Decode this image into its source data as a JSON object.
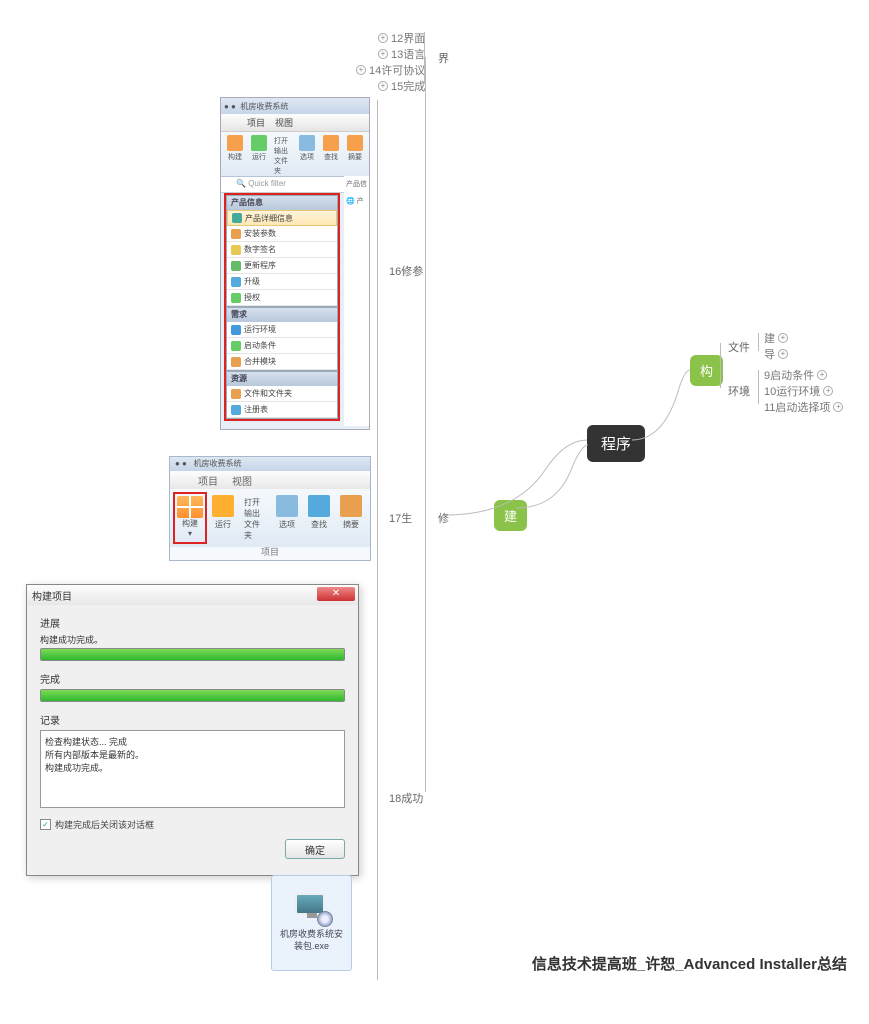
{
  "top_nodes": [
    {
      "label": "12界面"
    },
    {
      "label": "13语言"
    },
    {
      "label": "14许可协议"
    },
    {
      "label": "15完成"
    }
  ],
  "top_group": "界",
  "mid_label": "16修参",
  "panel1": {
    "title": "机房收费系统",
    "tabs": [
      "项目",
      "视图"
    ],
    "ribbon": [
      {
        "t": "构建",
        "c": "#f6a04c"
      },
      {
        "t": "运行",
        "c": "#6c6"
      },
      {
        "t": "打开输出文件夹",
        "c": "#5ad"
      },
      {
        "t": "选项",
        "c": "#8bd"
      },
      {
        "t": "查找",
        "c": "#f6a04c"
      },
      {
        "t": "摘要",
        "c": "#f6a04c"
      }
    ],
    "filter": "Quick filter",
    "right_tab": "产品信",
    "groups": [
      {
        "name": "产品信息",
        "items": [
          {
            "t": "产品详细信息",
            "c": "#4a9",
            "sel": true
          },
          {
            "t": "安装参数",
            "c": "#e8a050"
          },
          {
            "t": "数字签名",
            "c": "#e8c850"
          },
          {
            "t": "更新程序",
            "c": "#6b6"
          },
          {
            "t": "升级",
            "c": "#5ad"
          },
          {
            "t": "授权",
            "c": "#6c6"
          }
        ]
      },
      {
        "name": "需求",
        "items": [
          {
            "t": "运行环境",
            "c": "#4499dd"
          },
          {
            "t": "启动条件",
            "c": "#6c6"
          },
          {
            "t": "合并模块",
            "c": "#e8a050"
          }
        ]
      },
      {
        "name": "资源",
        "items": [
          {
            "t": "文件和文件夹",
            "c": "#e8a050"
          },
          {
            "t": "注册表",
            "c": "#5ad"
          }
        ]
      }
    ]
  },
  "panel2": {
    "title": "机房收费系统",
    "tabs": [
      "项目",
      "视图"
    ],
    "highlight": "构建",
    "btns": [
      {
        "t": "运行",
        "c": "#ffb030"
      },
      {
        "t": "打开输出文件夹",
        "c": "#5ad"
      },
      {
        "t": "选项",
        "c": "#8bd"
      },
      {
        "t": "查找",
        "c": "#5ad"
      },
      {
        "t": "摘要",
        "c": "#e8a050"
      }
    ],
    "section": "项目"
  },
  "side_17": "17生",
  "side_mod": "修",
  "dialog": {
    "title": "构建项目",
    "sec1": "进展",
    "msg1": "构建成功完成。",
    "sec2": "完成",
    "sec3": "记录",
    "log": [
      "检查构建状态... 完成",
      "所有内部版本是最新的。",
      "构建成功完成。"
    ],
    "chk": "构建完成后关闭该对话框",
    "ok": "确定"
  },
  "side_18": "18成功",
  "installer": "机房收费系统安装包.exe",
  "center": "程序",
  "right_build": "建",
  "right_gou": "构",
  "r_files": "文件",
  "r_files_c": [
    {
      "t": "建"
    },
    {
      "t": "导"
    }
  ],
  "r_env": "环境",
  "r_env_c": [
    {
      "t": "9启动条件"
    },
    {
      "t": "10运行环境"
    },
    {
      "t": "11启动选择项"
    }
  ],
  "footer": "信息技术提高班_许恕_Advanced Installer总结"
}
